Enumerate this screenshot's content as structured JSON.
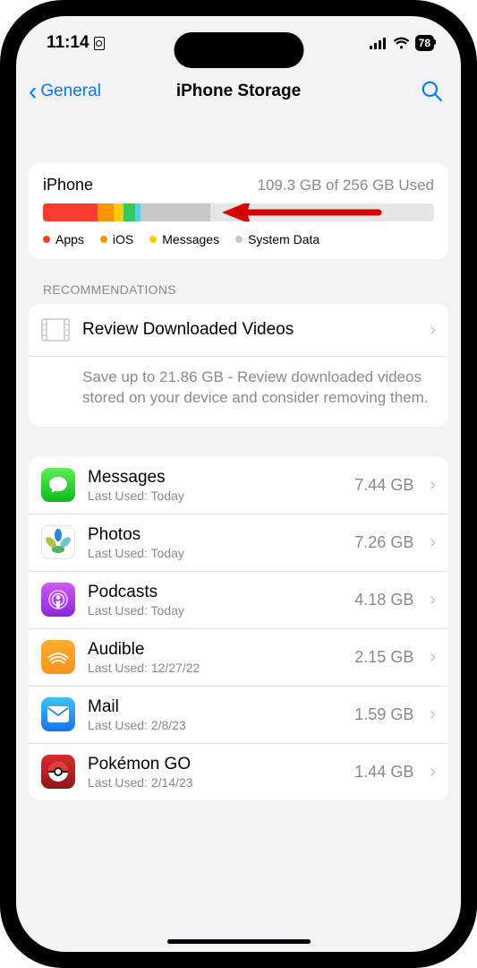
{
  "status": {
    "time": "11:14",
    "battery": "78"
  },
  "nav": {
    "back": "General",
    "title": "iPhone Storage"
  },
  "storage": {
    "device": "iPhone",
    "used_text": "109.3 GB of 256 GB Used",
    "segments": [
      {
        "color": "#ff3b30",
        "pct": 14
      },
      {
        "color": "#ff9500",
        "pct": 4
      },
      {
        "color": "#ffcc00",
        "pct": 2.5
      },
      {
        "color": "#34c759",
        "pct": 3
      },
      {
        "color": "#5ac8fa",
        "pct": 1.5
      },
      {
        "color": "#c7c7cc",
        "pct": 17.7
      }
    ],
    "legend": [
      {
        "color": "#ff3b30",
        "label": "Apps"
      },
      {
        "color": "#ff9500",
        "label": "iOS"
      },
      {
        "color": "#ffcc00",
        "label": "Messages"
      },
      {
        "color": "#c7c7cc",
        "label": "System Data"
      }
    ]
  },
  "recommendations": {
    "header": "RECOMMENDATIONS",
    "title": "Review Downloaded Videos",
    "desc": "Save up to 21.86 GB - Review downloaded videos stored on your device and consider removing them."
  },
  "apps": [
    {
      "icon": "messages",
      "name": "Messages",
      "sub": "Last Used: Today",
      "size": "7.44 GB"
    },
    {
      "icon": "photos",
      "name": "Photos",
      "sub": "Last Used: Today",
      "size": "7.26 GB"
    },
    {
      "icon": "podcasts",
      "name": "Podcasts",
      "sub": "Last Used: Today",
      "size": "4.18 GB"
    },
    {
      "icon": "audible",
      "name": "Audible",
      "sub": "Last Used: 12/27/22",
      "size": "2.15 GB"
    },
    {
      "icon": "mail",
      "name": "Mail",
      "sub": "Last Used: 2/8/23",
      "size": "1.59 GB"
    },
    {
      "icon": "pokemon",
      "name": "Pokémon GO",
      "sub": "Last Used: 2/14/23",
      "size": "1.44 GB"
    }
  ]
}
